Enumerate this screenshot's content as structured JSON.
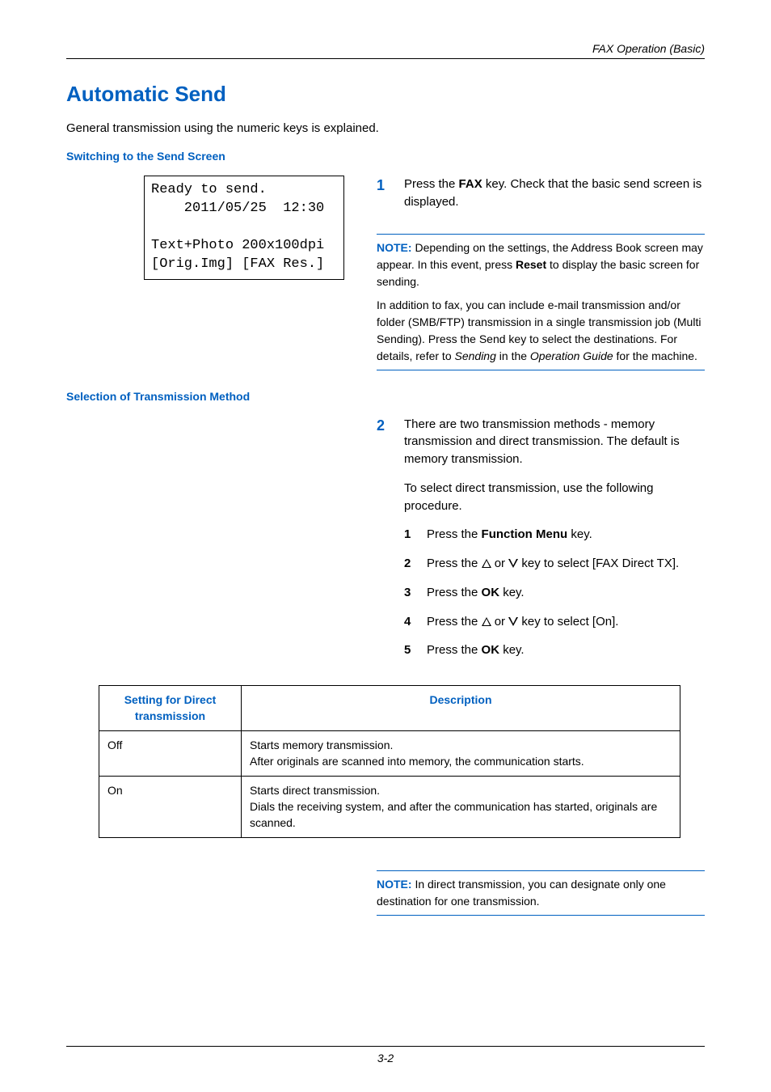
{
  "running_head": "FAX Operation (Basic)",
  "title": "Automatic Send",
  "intro": "General transmission using the numeric keys is explained.",
  "sub1": "Switching to the Send Screen",
  "lcd": {
    "l1": "Ready to send.",
    "l2": "    2011/05/25  12:30",
    "l3": "",
    "l4": "Text+Photo 200x100dpi",
    "l5": "[Orig.Img] [FAX Res.]"
  },
  "step1": {
    "num": "1",
    "before": "Press the ",
    "key": "FAX",
    "after": " key. Check that the basic send screen is displayed."
  },
  "note1": {
    "label": "NOTE:",
    "p1a": " Depending on the settings, the Address Book screen may appear. In this event, press ",
    "p1key": "Reset",
    "p1b": " to display the basic screen for sending.",
    "p2a": "In addition to fax, you can include e-mail transmission and/or folder (SMB/FTP) transmission in a single transmission job (Multi Sending). Press the Send key to select the destinations. For details, refer to ",
    "p2i1": "Sending",
    "p2mid": " in the ",
    "p2i2": "Operation Guide",
    "p2b": " for the machine."
  },
  "sub2": "Selection of Transmission Method",
  "step2": {
    "num": "2",
    "p1": "There are two transmission methods - memory transmission and direct transmission. The default is memory transmission.",
    "p2": "To select direct transmission, use the following procedure.",
    "s1": {
      "n": "1",
      "a": "Press the ",
      "k": "Function Menu",
      "b": " key."
    },
    "s2": {
      "n": "2",
      "a": "Press the ",
      "b": " or ",
      "c": " key to select [FAX Direct TX]."
    },
    "s3": {
      "n": "3",
      "a": "Press the ",
      "k": "OK",
      "b": " key."
    },
    "s4": {
      "n": "4",
      "a": "Press the ",
      "b": " or ",
      "c": " key to select [On]."
    },
    "s5": {
      "n": "5",
      "a": "Press the ",
      "k": "OK",
      "b": " key."
    }
  },
  "table": {
    "h1": "Setting for Direct transmission",
    "h2": "Description",
    "r1c1": "Off",
    "r1c2": "Starts memory transmission.\nAfter originals are scanned into memory, the communication starts.",
    "r2c1": "On",
    "r2c2": "Starts direct transmission.\nDials the receiving system, and after the communication has started, originals are scanned."
  },
  "note2": {
    "label": "NOTE:",
    "text": " In direct transmission, you can designate only one destination for one transmission."
  },
  "pagenum": "3-2"
}
